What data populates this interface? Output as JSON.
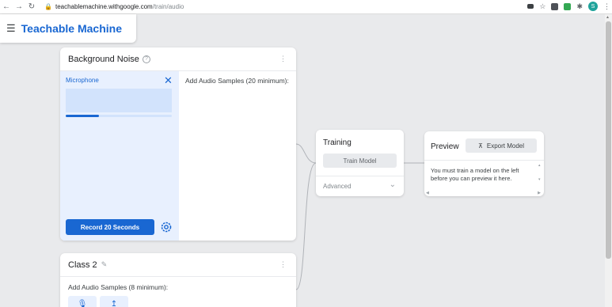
{
  "browser": {
    "url_host": "teachablemachine.withgoogle.com",
    "url_path": "/train/audio",
    "profile_initial": "S"
  },
  "header": {
    "title": "Teachable Machine"
  },
  "classes": [
    {
      "name": "Background Noise",
      "input_source": "Microphone",
      "samples_prompt": "Add Audio Samples (20 minimum):",
      "record_button": "Record 20 Seconds",
      "recording_progress_percent": 31
    },
    {
      "name": "Class 2",
      "samples_prompt": "Add Audio Samples (8 minimum):"
    }
  ],
  "training": {
    "title": "Training",
    "train_button": "Train Model",
    "advanced_label": "Advanced"
  },
  "preview": {
    "title": "Preview",
    "export_button": "Export Model",
    "message": "You must train a model on the left before you can preview it here."
  },
  "colors": {
    "accent": "#1967d2",
    "panel_tint": "#e8f0fe",
    "background": "#e9eaec"
  }
}
